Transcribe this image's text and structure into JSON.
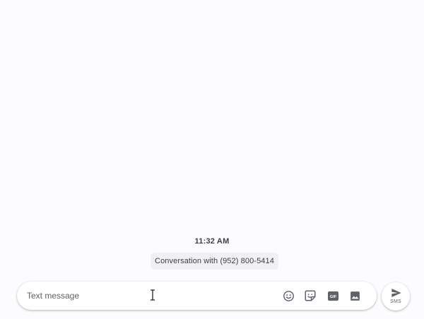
{
  "conversation": {
    "timestamp": "11:32 AM",
    "info_chip": "Conversation with (952) 800-5414"
  },
  "compose": {
    "placeholder": "Text message",
    "value": "",
    "tools": [
      {
        "name": "emoji-icon"
      },
      {
        "name": "sticker-icon"
      },
      {
        "name": "gif-icon",
        "label": "GIF"
      },
      {
        "name": "image-icon"
      }
    ]
  },
  "send": {
    "label": "SMS",
    "icon": "send-icon"
  },
  "colors": {
    "background": "#fcfbfd",
    "chip_background": "#f1f0f3",
    "icon": "#5f6368",
    "text": "#3c4043"
  }
}
